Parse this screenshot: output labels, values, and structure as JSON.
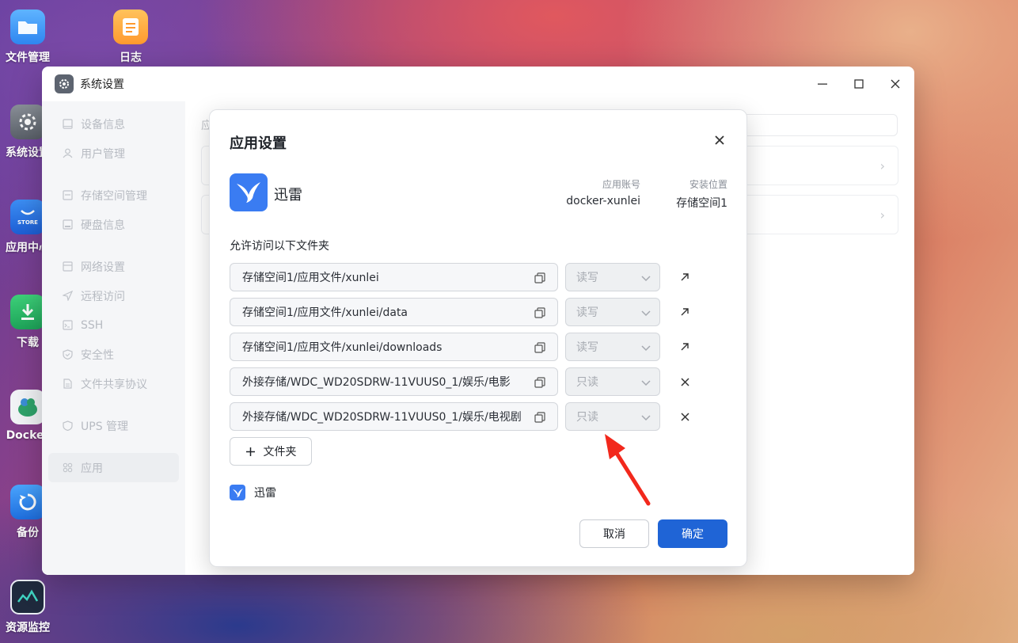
{
  "desktop": {
    "icons": [
      {
        "label": "文件管理",
        "icon": "folder-icon"
      },
      {
        "label": "日志",
        "icon": "notes-icon"
      },
      {
        "label": "系统设置",
        "icon": "gear-icon"
      },
      {
        "label": "应用中心",
        "icon": "store-icon"
      },
      {
        "label": "下载",
        "icon": "download-icon"
      },
      {
        "label": "Docker",
        "icon": "docker-icon"
      },
      {
        "label": "备份",
        "icon": "backup-icon"
      },
      {
        "label": "资源监控",
        "icon": "monitor-icon"
      }
    ],
    "store_badge": "STORE"
  },
  "window": {
    "title": "系统设置",
    "sidebar": [
      {
        "label": "设备信息",
        "icon": "device-icon"
      },
      {
        "label": "用户管理",
        "icon": "user-icon"
      },
      {
        "label": "存储空间管理",
        "icon": "storage-icon"
      },
      {
        "label": "硬盘信息",
        "icon": "disk-icon"
      },
      {
        "label": "网络设置",
        "icon": "network-icon"
      },
      {
        "label": "远程访问",
        "icon": "remote-icon"
      },
      {
        "label": "SSH",
        "icon": "terminal-icon"
      },
      {
        "label": "安全性",
        "icon": "shield-icon"
      },
      {
        "label": "文件共享协议",
        "icon": "file-icon"
      },
      {
        "label": "UPS 管理",
        "icon": "ups-icon"
      },
      {
        "label": "应用",
        "icon": "apps-icon"
      }
    ],
    "main_heading_partial": "应"
  },
  "modal": {
    "title": "应用设置",
    "app_name": "迅雷",
    "account_label": "应用账号",
    "account_value": "docker-xunlei",
    "location_label": "安装位置",
    "location_value": "存储空间1",
    "section_label": "允许访问以下文件夹",
    "folders": [
      {
        "path": "存储空间1/应用文件/xunlei",
        "permission": "读写",
        "action": "open-icon"
      },
      {
        "path": "存储空间1/应用文件/xunlei/data",
        "permission": "读写",
        "action": "open-icon"
      },
      {
        "path": "存储空间1/应用文件/xunlei/downloads",
        "permission": "读写",
        "action": "open-icon"
      },
      {
        "path": "外接存储/WDC_WD20SDRW-11VUUS0_1/娱乐/电影",
        "permission": "只读",
        "action": "remove-icon"
      },
      {
        "path": "外接存储/WDC_WD20SDRW-11VUUS0_1/娱乐/电视剧",
        "permission": "只读",
        "action": "remove-icon"
      }
    ],
    "add_folder_label": "文件夹",
    "app_check_label": "迅雷",
    "cancel_label": "取消",
    "confirm_label": "确定"
  },
  "colors": {
    "primary": "#1f64d6",
    "xunlei_blue": "#3a7cf2",
    "annotation_red": "#f2281c"
  }
}
